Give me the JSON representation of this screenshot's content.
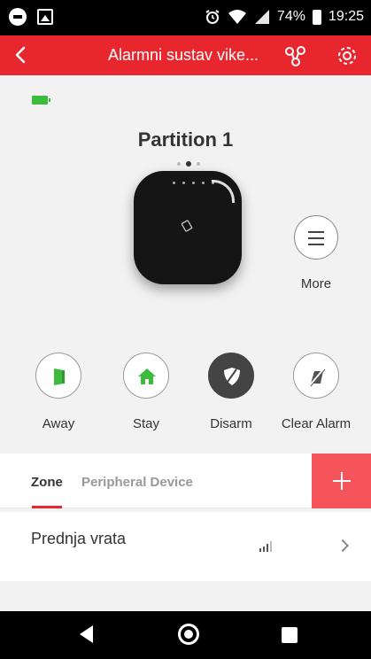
{
  "status_bar": {
    "icons_left": [
      "minus-circle-icon",
      "image-icon"
    ],
    "icons_right": [
      "alarm-clock-icon",
      "wifi-icon",
      "signal-icon",
      "battery-icon"
    ],
    "battery_percent": "74%",
    "time": "19:25"
  },
  "app_bar": {
    "title": "Alarmni sustav vike...",
    "background": "#e8262e",
    "icons": [
      "back-icon",
      "share-icon",
      "settings-icon"
    ]
  },
  "panel": {
    "battery_status_color": "#3dbb3d",
    "partition_title": "Partition 1",
    "pager": {
      "pages": 3,
      "active": 2
    },
    "more_label": "More"
  },
  "actions": [
    {
      "label": "Away",
      "icon": "away-icon",
      "color": "#3dbb3d"
    },
    {
      "label": "Stay",
      "icon": "home-icon",
      "color": "#3dbb3d"
    },
    {
      "label": "Disarm",
      "icon": "shield-icon",
      "active": true
    },
    {
      "label": "Clear Alarm",
      "icon": "clear-alarm-icon"
    }
  ],
  "tabs": {
    "items": [
      {
        "label": "Zone",
        "selected": true
      },
      {
        "label": "Peripheral Device",
        "selected": false
      }
    ],
    "add_icon": "plus-icon",
    "accent": "#f4545a"
  },
  "zones": [
    {
      "name": "Prednja vrata",
      "signal_icon": "signal-bars-icon"
    }
  ],
  "nav_bar": {
    "icons": [
      "nav-back-icon",
      "nav-home-icon",
      "nav-recent-icon"
    ]
  }
}
